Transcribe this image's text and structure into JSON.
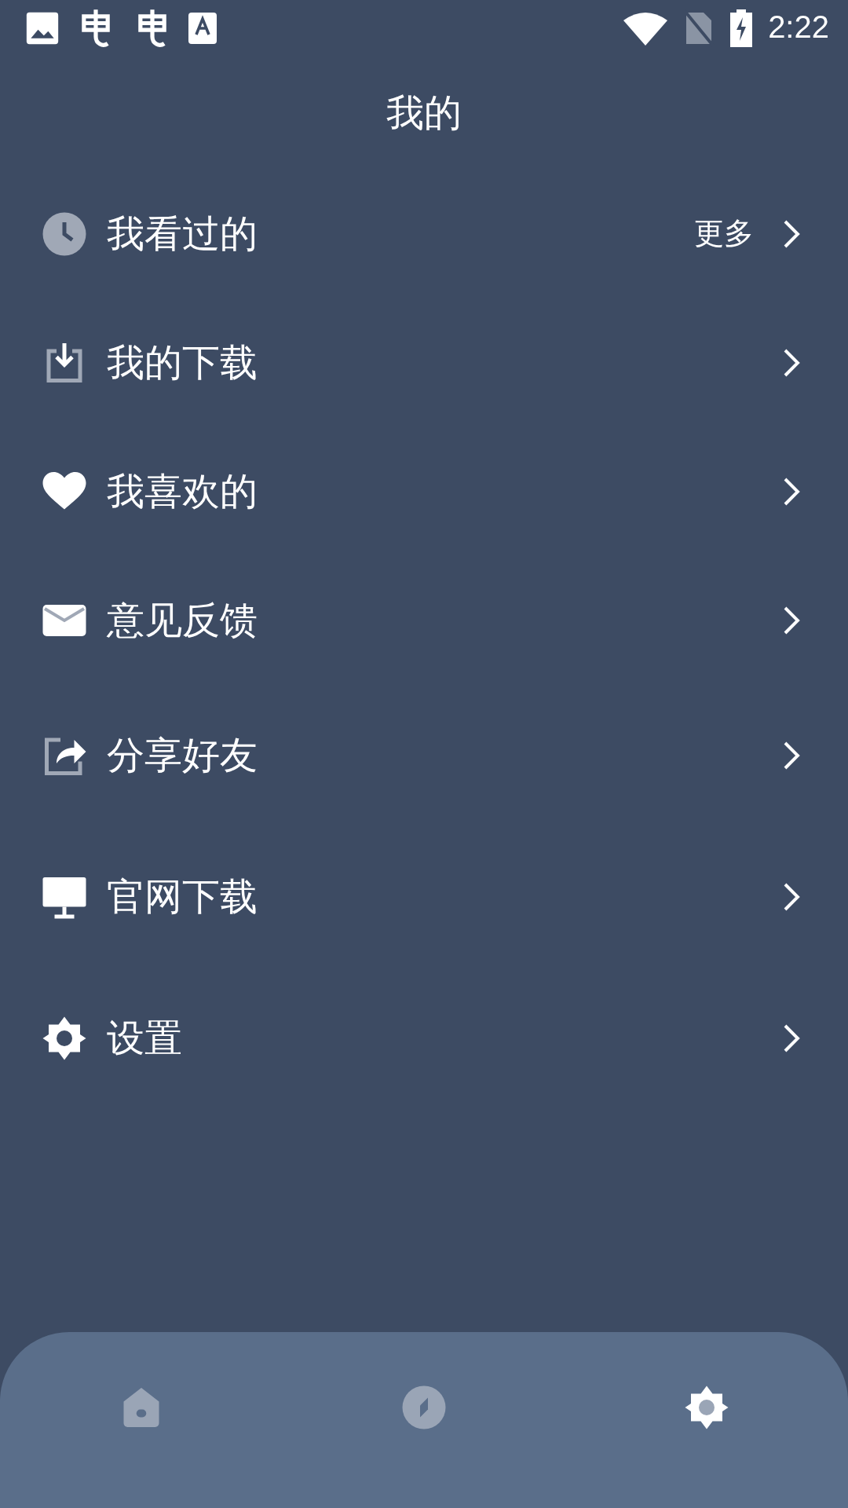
{
  "status_bar": {
    "time": "2:22"
  },
  "header": {
    "title": "我的"
  },
  "menu": [
    {
      "label": "我看过的",
      "extra": "更多"
    },
    {
      "label": "我的下载"
    },
    {
      "label": "我喜欢的"
    },
    {
      "label": "意见反馈"
    },
    {
      "label": "分享好友"
    },
    {
      "label": "官网下载"
    },
    {
      "label": "设置"
    }
  ],
  "bottom_nav": [
    {
      "selected": false
    },
    {
      "selected": false
    },
    {
      "selected": true
    }
  ]
}
